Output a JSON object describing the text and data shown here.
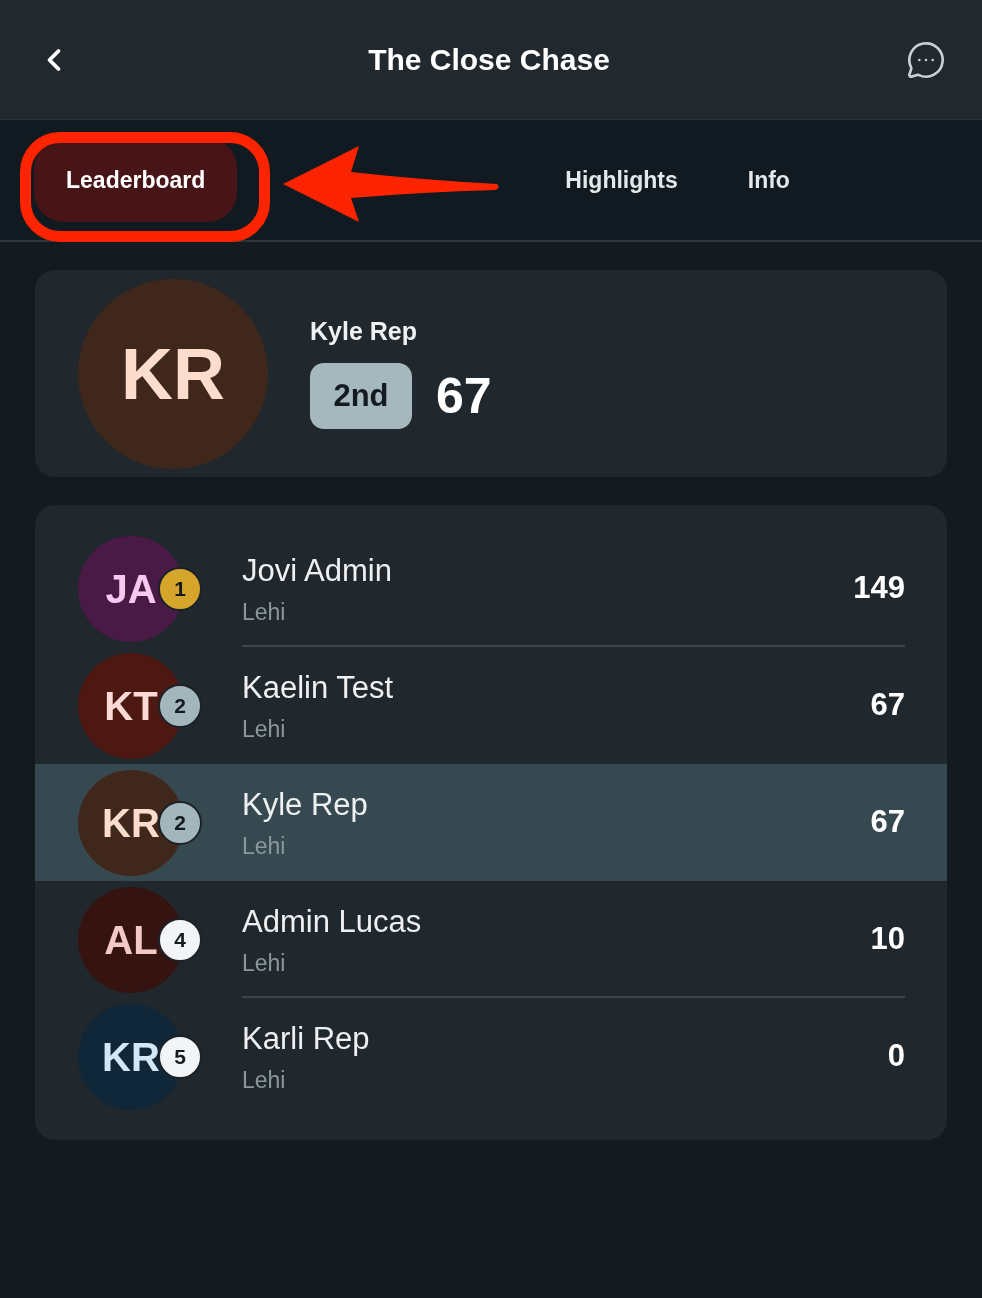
{
  "header": {
    "title": "The Close Chase"
  },
  "tabs": [
    {
      "label": "Leaderboard",
      "selected": true
    },
    {
      "label": "Highlights",
      "selected": false
    },
    {
      "label": "Info",
      "selected": false
    }
  ],
  "annotation": {
    "kind": "circle-and-arrow"
  },
  "me": {
    "initials": {
      "text": "KR",
      "color": "#fcdccd"
    },
    "color": "#40271b",
    "name": "Kyle Rep",
    "rank": "2nd",
    "score": "67"
  },
  "rows": [
    {
      "initials": {
        "text": "JA",
        "color": "#f6c9f0"
      },
      "color": "#481a45",
      "badge": {
        "label": "1",
        "color": "#d6a52c"
      },
      "name": "Jovi Admin",
      "location": "Lehi",
      "score": "149",
      "selected": false
    },
    {
      "initials": {
        "text": "KT",
        "color": "#fbdad5"
      },
      "color": "#4e1812",
      "badge": {
        "label": "2",
        "color": "#a3b6bc"
      },
      "name": "Kaelin Test",
      "location": "Lehi",
      "score": "67",
      "selected": false
    },
    {
      "initials": {
        "text": "KR",
        "color": "#fcdccd"
      },
      "color": "#40271b",
      "badge": {
        "label": "2",
        "color": "#a3b6bc"
      },
      "name": "Kyle Rep",
      "location": "Lehi",
      "score": "67",
      "selected": true
    },
    {
      "initials": {
        "text": "AL",
        "color": "#f3c9c6"
      },
      "color": "#351311",
      "badge": {
        "label": "4",
        "color": "#f3f4f5"
      },
      "name": "Admin Lucas",
      "location": "Lehi",
      "score": "10",
      "selected": false
    },
    {
      "initials": {
        "text": "KR",
        "color": "#d3e8f6"
      },
      "color": "#0f2738",
      "badge": {
        "label": "5",
        "color": "#f3f4f5"
      },
      "name": "Karli Rep",
      "location": "Lehi",
      "score": "0",
      "selected": false
    }
  ]
}
